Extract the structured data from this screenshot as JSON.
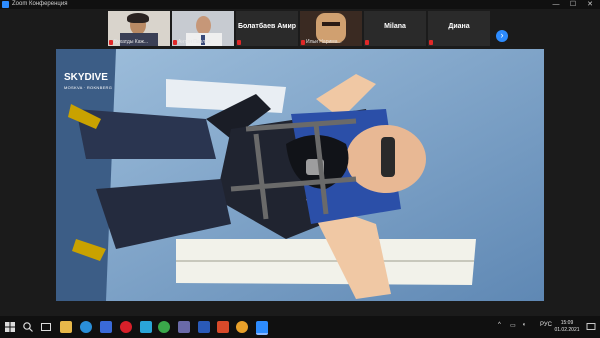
{
  "window": {
    "title": "Zoom Конференция",
    "min_label": "—",
    "max_label": "☐",
    "close_label": "✕"
  },
  "participants": [
    {
      "name": "Бухатды Каж..."
    },
    {
      "name": "Антон Павлов"
    },
    {
      "name": "Болатбаев Амир"
    },
    {
      "name": "Ильи Нарима..."
    },
    {
      "name": "Milana"
    },
    {
      "name": "Диана"
    }
  ],
  "strip_next_label": "›",
  "video": {
    "logo_main": "SKYDIVE",
    "logo_sub": "MOSKVA · ROKNBERG"
  },
  "taskbar": {
    "lang": "РУС",
    "time": "15:09",
    "date": "01.02.2021"
  },
  "colors": {
    "accent": "#2d8cff",
    "mic_muted": "#e02828"
  }
}
